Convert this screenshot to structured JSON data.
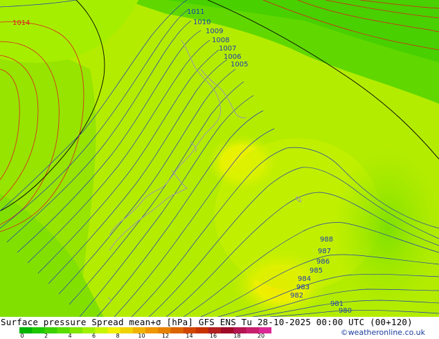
{
  "footer": {
    "title": "Surface pressure Spread mean+σ [hPa] GFS ENS  Tu 28-10-2025 00:00 UTC (00+120)",
    "credit": "©weatheronline.co.uk"
  },
  "legend": {
    "ticks": [
      "0",
      "2",
      "4",
      "6",
      "8",
      "10",
      "12",
      "14",
      "16",
      "18",
      "20"
    ],
    "colors": [
      "#00b400",
      "#1ec800",
      "#3cd200",
      "#5ade00",
      "#82e600",
      "#a0f000",
      "#c8f500",
      "#f0f000",
      "#f0d200",
      "#f0b400",
      "#f09600",
      "#e68200",
      "#dc6400",
      "#d24600",
      "#c83200",
      "#b41e1e",
      "#a00a28",
      "#b41450",
      "#c81e6e",
      "#dc2896"
    ]
  },
  "isobars": {
    "labels": [
      "1014",
      "1011",
      "1010",
      "1009",
      "1008",
      "1007",
      "1006",
      "1005",
      "988",
      "987",
      "986",
      "985",
      "984",
      "983",
      "982",
      "981",
      "980"
    ]
  },
  "colors": {
    "isobar_blue": "#1e3cb4",
    "isobar_red": "#dc1e1e",
    "isobar_black": "#000000",
    "coast": "#a0a0a0"
  }
}
